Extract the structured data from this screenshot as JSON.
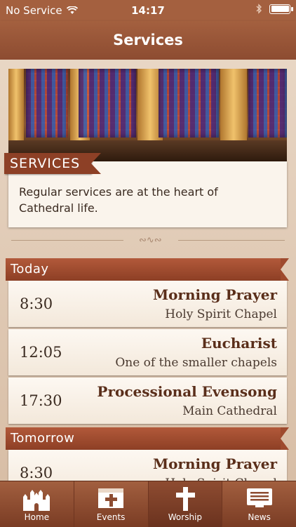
{
  "status_bar": {
    "carrier": "No Service",
    "time": "14:17"
  },
  "nav": {
    "title": "Services"
  },
  "intro": {
    "ribbon": "SERVICES",
    "text": "Regular services are at the heart of Cathedral life."
  },
  "sections": [
    {
      "title": "Today",
      "events": [
        {
          "time": "8:30",
          "title": "Morning Prayer",
          "place": "Holy Spirit Chapel"
        },
        {
          "time": "12:05",
          "title": "Eucharist",
          "place": "One of the smaller chapels"
        },
        {
          "time": "17:30",
          "title": "Processional Evensong",
          "place": "Main Cathedral"
        }
      ]
    },
    {
      "title": "Tomorrow",
      "events": [
        {
          "time": "8:30",
          "title": "Morning Prayer",
          "place": "Holy Spirit Chapel"
        }
      ]
    }
  ],
  "tabs": [
    {
      "label": "Home",
      "icon": "cathedral-icon"
    },
    {
      "label": "Events",
      "icon": "calendar-cross-icon"
    },
    {
      "label": "Worship",
      "icon": "cross-icon",
      "active": true
    },
    {
      "label": "News",
      "icon": "newspaper-icon"
    }
  ],
  "colors": {
    "nav_bar": "#a4603f",
    "ribbon": "#8d4026",
    "card": "#faf4ec",
    "background": "#d9c2ab",
    "heading_text": "#5a2e1a"
  }
}
